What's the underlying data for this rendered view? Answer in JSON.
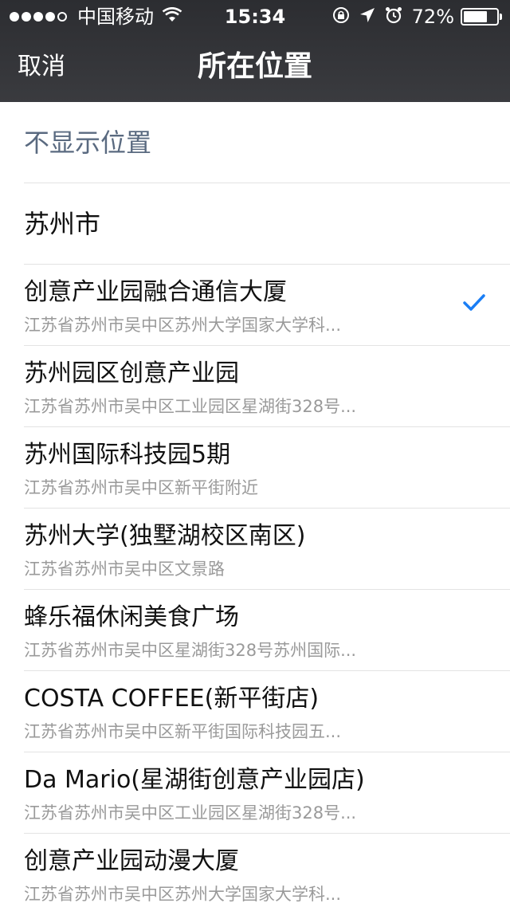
{
  "status_bar": {
    "carrier": "中国移动",
    "time": "15:34",
    "battery_percent": "72%",
    "battery_level": 0.72,
    "icons": [
      "signal-dots",
      "wifi-icon",
      "rotation-lock-icon",
      "location-arrow-icon",
      "alarm-icon",
      "battery-icon"
    ]
  },
  "nav": {
    "cancel_label": "取消",
    "title": "所在位置"
  },
  "options": {
    "hide_location": "不显示位置",
    "city": "苏州市"
  },
  "places": [
    {
      "name": "创意产业园融合通信大厦",
      "address": "江苏省苏州市吴中区苏州大学国家大学科...",
      "selected": true
    },
    {
      "name": "苏州园区创意产业园",
      "address": "江苏省苏州市吴中区工业园区星湖街328号...",
      "selected": false
    },
    {
      "name": "苏州国际科技园5期",
      "address": "江苏省苏州市吴中区新平街附近",
      "selected": false
    },
    {
      "name": "苏州大学(独墅湖校区南区)",
      "address": "江苏省苏州市吴中区文景路",
      "selected": false
    },
    {
      "name": "蜂乐福休闲美食广场",
      "address": "江苏省苏州市吴中区星湖街328号苏州国际...",
      "selected": false
    },
    {
      "name": "COSTA COFFEE(新平街店)",
      "address": "江苏省苏州市吴中区新平街国际科技园五...",
      "selected": false
    },
    {
      "name": "Da Mario(星湖街创意产业园店)",
      "address": "江苏省苏州市吴中区工业园区星湖街328号...",
      "selected": false
    },
    {
      "name": "创意产业园动漫大厦",
      "address": "江苏省苏州市吴中区苏州大学国家大学科...",
      "selected": false
    }
  ],
  "colors": {
    "nav_background": "#333438",
    "accent_check": "#1a7ef5",
    "muted_option": "#5a6a80",
    "address_text": "#9a9a9a"
  }
}
